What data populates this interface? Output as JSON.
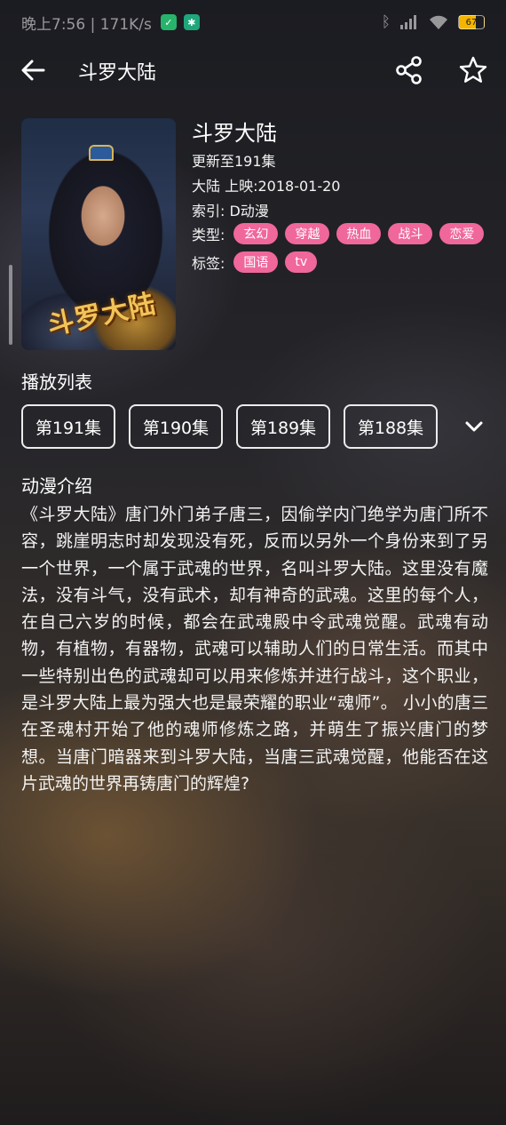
{
  "status_bar": {
    "text": "晚上7:56 | 171K/s",
    "battery": "67"
  },
  "header": {
    "title": "斗罗大陆"
  },
  "anime": {
    "name": "斗罗大陆",
    "update": "更新至191集",
    "region_release": "大陆   上映:2018-01-20",
    "index": "索引: D动漫",
    "genre_label": "类型:",
    "genres": [
      "玄幻",
      "穿越",
      "热血",
      "战斗",
      "恋爱"
    ],
    "tags_label": "标签:",
    "tags": [
      "国语",
      "tv"
    ],
    "poster_logo": "斗罗大陆"
  },
  "playlist": {
    "title": "播放列表",
    "episodes": [
      "第191集",
      "第190集",
      "第189集",
      "第188集"
    ]
  },
  "intro": {
    "title": "动漫介绍",
    "text": "《斗罗大陆》唐门外门弟子唐三，因偷学内门绝学为唐门所不容，跳崖明志时却发现没有死，反而以另外一个身份来到了另一个世界，一个属于武魂的世界，名叫斗罗大陆。这里没有魔法，没有斗气，没有武术，却有神奇的武魂。这里的每个人，在自己六岁的时候，都会在武魂殿中令武魂觉醒。武魂有动物，有植物，有器物，武魂可以辅助人们的日常生活。而其中一些特别出色的武魂却可以用来修炼并进行战斗，这个职业，是斗罗大陆上最为强大也是最荣耀的职业“魂师”。 小小的唐三在圣魂村开始了他的魂师修炼之路，并萌生了振兴唐门的梦想。当唐门暗器来到斗罗大陆，当唐三武魂觉醒，他能否在这片武魂的世界再铸唐门的辉煌?"
  },
  "colors": {
    "tag_pink": "#f0679b",
    "episode_border": "#ececec"
  }
}
